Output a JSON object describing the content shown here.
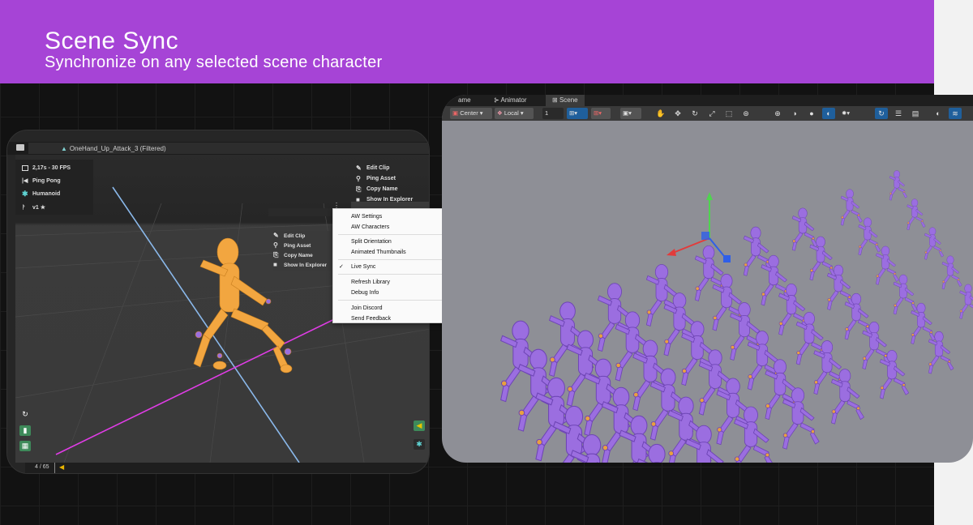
{
  "banner": {
    "title": "Scene Sync",
    "subtitle": "Synchronize on any selected scene character",
    "color": "#a644d6"
  },
  "left_panel": {
    "tab_title": "OneHand_Up_Attack_3 (Filtered)",
    "info": {
      "fps": "2,17s - 30 FPS",
      "loop_mode": "Ping Pong",
      "rig": "Humanoid",
      "version": "v1 ★"
    },
    "clip_actions": [
      "Edit Clip",
      "Ping Asset",
      "Copy Name",
      "Show In Explorer"
    ],
    "clip_actions_bg": [
      "Edit Clip",
      "Ping Asset",
      "Copy Name",
      "Show In Explorer"
    ],
    "dots": "⋮",
    "frame_counter": "/ 65",
    "frame_prefix": "4",
    "character_color": "#f2a640"
  },
  "menu": {
    "group1": [
      "AW Settings",
      "AW Characters"
    ],
    "group2": [
      {
        "label": "Split Orientation",
        "submenu": true
      },
      {
        "label": "Animated Thumbnails",
        "submenu": true
      }
    ],
    "group3": [
      {
        "label": "Live Sync",
        "checked": true
      }
    ],
    "group4": [
      "Refresh Library",
      "Debug Info"
    ],
    "group5": [
      "Join Discord",
      "Send Feedback"
    ],
    "check_glyph": "✓",
    "arrow_glyph": "›"
  },
  "scene_panel": {
    "tabs": [
      "ame",
      "Animator",
      "Scene"
    ],
    "active_tab": "Scene",
    "toolbar": {
      "pivot": "Center",
      "space": "Local",
      "snap_value": "1"
    },
    "character_color": "#9b6ee0",
    "background": "#8e8f96"
  },
  "icons": {
    "folder": "folder-icon",
    "refresh": "refresh-icon",
    "camera": "camera-icon",
    "grid": "grid-icon",
    "speaker": "speaker-icon",
    "humanoid": "humanoid-icon"
  }
}
